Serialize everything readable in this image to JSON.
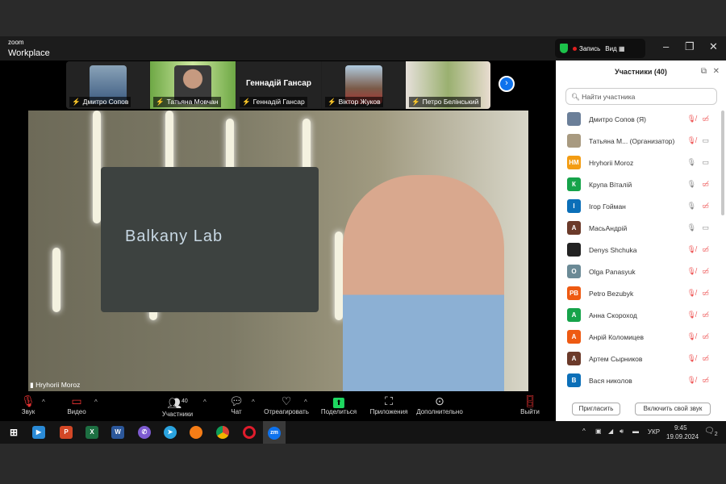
{
  "app": {
    "logo_small": "zoom",
    "logo_big": "Workplace",
    "record_label": "Запись",
    "view_label": "Вид"
  },
  "thumbnails": [
    {
      "name": "Дмитро Сопов"
    },
    {
      "name": "Татьяна Мовчан"
    },
    {
      "name": "Геннадій Гансар",
      "display": "Геннадій Гансар"
    },
    {
      "name": "Віктор Жуков"
    },
    {
      "name": "Петро Белінський"
    }
  ],
  "video": {
    "speaker": "Hryhorii Moroz",
    "wall_text": "Balkany Lab"
  },
  "toolbar": {
    "audio": "Звук",
    "video": "Видео",
    "participants": "Участники",
    "participants_count": "40",
    "chat": "Чат",
    "react": "Отреагировать",
    "share": "Поделиться",
    "apps": "Приложения",
    "more": "Дополнительно",
    "leave": "Выйти"
  },
  "panel": {
    "title": "Участники (40)",
    "search_placeholder": "Найти участника",
    "invite": "Пригласить",
    "unmute": "Включить свой звук",
    "participants": [
      {
        "name": "Дмитро Сопов (Я)",
        "initials": "",
        "color": "#6b7f99",
        "mic": "muted",
        "cam": "off"
      },
      {
        "name": "Татьяна М...  (Организатор)",
        "initials": "",
        "color": "#a89a80",
        "mic": "muted",
        "cam": "on"
      },
      {
        "name": "Hryhorii Moroz",
        "initials": "HM",
        "color": "#f39c12",
        "mic": "on",
        "cam": "on"
      },
      {
        "name": "Крупа Віталій",
        "initials": "К",
        "color": "#16a34a",
        "mic": "on",
        "cam": "off"
      },
      {
        "name": "Ігор Гойман",
        "initials": "І",
        "color": "#0b6fb8",
        "mic": "on",
        "cam": "off"
      },
      {
        "name": "МасьАндрій",
        "initials": "А",
        "color": "#6b3a2a",
        "mic": "on",
        "cam": "on"
      },
      {
        "name": "Denys Shchuka",
        "initials": "",
        "color": "#222222",
        "mic": "muted",
        "cam": "off"
      },
      {
        "name": "Olga Panasyuk",
        "initials": "O",
        "color": "#6b8a96",
        "mic": "muted",
        "cam": "off"
      },
      {
        "name": "Petro Bezubyk",
        "initials": "PB",
        "color": "#ee5a12",
        "mic": "muted",
        "cam": "off"
      },
      {
        "name": "Анна Скороход",
        "initials": "А",
        "color": "#16a34a",
        "mic": "muted",
        "cam": "off"
      },
      {
        "name": "Анрій Коломицев",
        "initials": "А",
        "color": "#ee5a12",
        "mic": "muted",
        "cam": "off"
      },
      {
        "name": "Артем Сырников",
        "initials": "А",
        "color": "#6b3a2a",
        "mic": "muted",
        "cam": "off"
      },
      {
        "name": "Вася николов",
        "initials": "В",
        "color": "#0b6fb8",
        "mic": "muted",
        "cam": "off"
      }
    ]
  },
  "taskbar": {
    "lang": "УКР",
    "time": "9:45",
    "date": "19.09.2024",
    "notifications": "2",
    "zoom_icon": "zm"
  }
}
